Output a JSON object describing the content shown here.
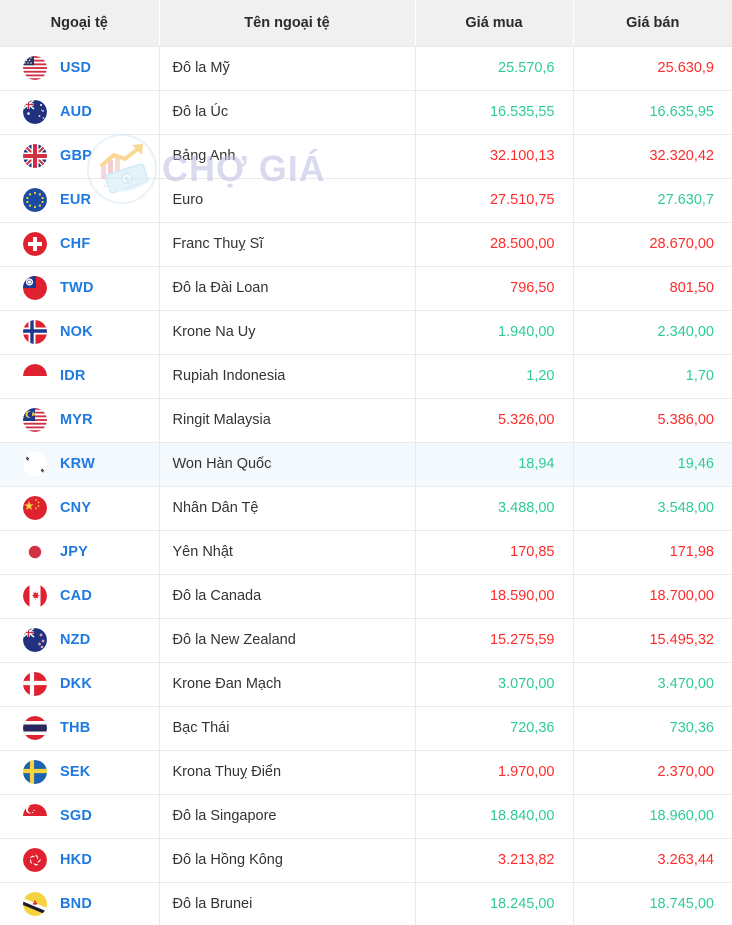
{
  "watermark": {
    "text": "CHỢ GIÁ",
    "logo_icon": "chart-money-logo-icon"
  },
  "colors": {
    "up": "#2ecc95",
    "down": "#ff2b2b",
    "code": "#1f7ae0",
    "header_bg": "#f0f0f0",
    "row_highlight": "#f4f9fd"
  },
  "table": {
    "columns": [
      {
        "key": "code",
        "label": "Ngoại tệ"
      },
      {
        "key": "name",
        "label": "Tên ngoại tệ"
      },
      {
        "key": "buy",
        "label": "Giá mua"
      },
      {
        "key": "sell",
        "label": "Giá bán"
      }
    ],
    "rows": [
      {
        "code": "USD",
        "flag": "flag-us",
        "name": "Đô la Mỹ",
        "buy": "25.570,6",
        "buy_dir": "up",
        "sell": "25.630,9",
        "sell_dir": "down",
        "highlight": false
      },
      {
        "code": "AUD",
        "flag": "flag-au",
        "name": "Đô la Úc",
        "buy": "16.535,55",
        "buy_dir": "up",
        "sell": "16.635,95",
        "sell_dir": "up",
        "highlight": false
      },
      {
        "code": "GBP",
        "flag": "flag-gb",
        "name": "Bảng Anh",
        "buy": "32.100,13",
        "buy_dir": "down",
        "sell": "32.320,42",
        "sell_dir": "down",
        "highlight": false
      },
      {
        "code": "EUR",
        "flag": "flag-eu",
        "name": "Euro",
        "buy": "27.510,75",
        "buy_dir": "down",
        "sell": "27.630,7",
        "sell_dir": "up",
        "highlight": false
      },
      {
        "code": "CHF",
        "flag": "flag-ch",
        "name": "Franc Thuỵ Sĩ",
        "buy": "28.500,00",
        "buy_dir": "down",
        "sell": "28.670,00",
        "sell_dir": "down",
        "highlight": false
      },
      {
        "code": "TWD",
        "flag": "flag-tw",
        "name": "Đô la Đài Loan",
        "buy": "796,50",
        "buy_dir": "down",
        "sell": "801,50",
        "sell_dir": "down",
        "highlight": false
      },
      {
        "code": "NOK",
        "flag": "flag-no",
        "name": "Krone Na Uy",
        "buy": "1.940,00",
        "buy_dir": "up",
        "sell": "2.340,00",
        "sell_dir": "up",
        "highlight": false
      },
      {
        "code": "IDR",
        "flag": "flag-id",
        "name": "Rupiah Indonesia",
        "buy": "1,20",
        "buy_dir": "up",
        "sell": "1,70",
        "sell_dir": "up",
        "highlight": false
      },
      {
        "code": "MYR",
        "flag": "flag-my",
        "name": "Ringit Malaysia",
        "buy": "5.326,00",
        "buy_dir": "down",
        "sell": "5.386,00",
        "sell_dir": "down",
        "highlight": false
      },
      {
        "code": "KRW",
        "flag": "flag-kr",
        "name": "Won Hàn Quốc",
        "buy": "18,94",
        "buy_dir": "up",
        "sell": "19,46",
        "sell_dir": "up",
        "highlight": true
      },
      {
        "code": "CNY",
        "flag": "flag-cn",
        "name": "Nhân Dân Tệ",
        "buy": "3.488,00",
        "buy_dir": "up",
        "sell": "3.548,00",
        "sell_dir": "up",
        "highlight": false
      },
      {
        "code": "JPY",
        "flag": "flag-jp",
        "name": "Yên Nhật",
        "buy": "170,85",
        "buy_dir": "down",
        "sell": "171,98",
        "sell_dir": "down",
        "highlight": false
      },
      {
        "code": "CAD",
        "flag": "flag-ca",
        "name": "Đô la Canada",
        "buy": "18.590,00",
        "buy_dir": "down",
        "sell": "18.700,00",
        "sell_dir": "down",
        "highlight": false
      },
      {
        "code": "NZD",
        "flag": "flag-nz",
        "name": "Đô la New Zealand",
        "buy": "15.275,59",
        "buy_dir": "down",
        "sell": "15.495,32",
        "sell_dir": "down",
        "highlight": false
      },
      {
        "code": "DKK",
        "flag": "flag-dk",
        "name": "Krone Đan Mạch",
        "buy": "3.070,00",
        "buy_dir": "up",
        "sell": "3.470,00",
        "sell_dir": "up",
        "highlight": false
      },
      {
        "code": "THB",
        "flag": "flag-th",
        "name": "Bạc Thái",
        "buy": "720,36",
        "buy_dir": "up",
        "sell": "730,36",
        "sell_dir": "up",
        "highlight": false
      },
      {
        "code": "SEK",
        "flag": "flag-se",
        "name": "Krona Thuỵ Điển",
        "buy": "1.970,00",
        "buy_dir": "down",
        "sell": "2.370,00",
        "sell_dir": "down",
        "highlight": false
      },
      {
        "code": "SGD",
        "flag": "flag-sg",
        "name": "Đô la Singapore",
        "buy": "18.840,00",
        "buy_dir": "up",
        "sell": "18.960,00",
        "sell_dir": "up",
        "highlight": false
      },
      {
        "code": "HKD",
        "flag": "flag-hk",
        "name": "Đô la Hồng Kông",
        "buy": "3.213,82",
        "buy_dir": "down",
        "sell": "3.263,44",
        "sell_dir": "down",
        "highlight": false
      },
      {
        "code": "BND",
        "flag": "flag-bn",
        "name": "Đô la Brunei",
        "buy": "18.245,00",
        "buy_dir": "up",
        "sell": "18.745,00",
        "sell_dir": "up",
        "highlight": false
      }
    ]
  }
}
